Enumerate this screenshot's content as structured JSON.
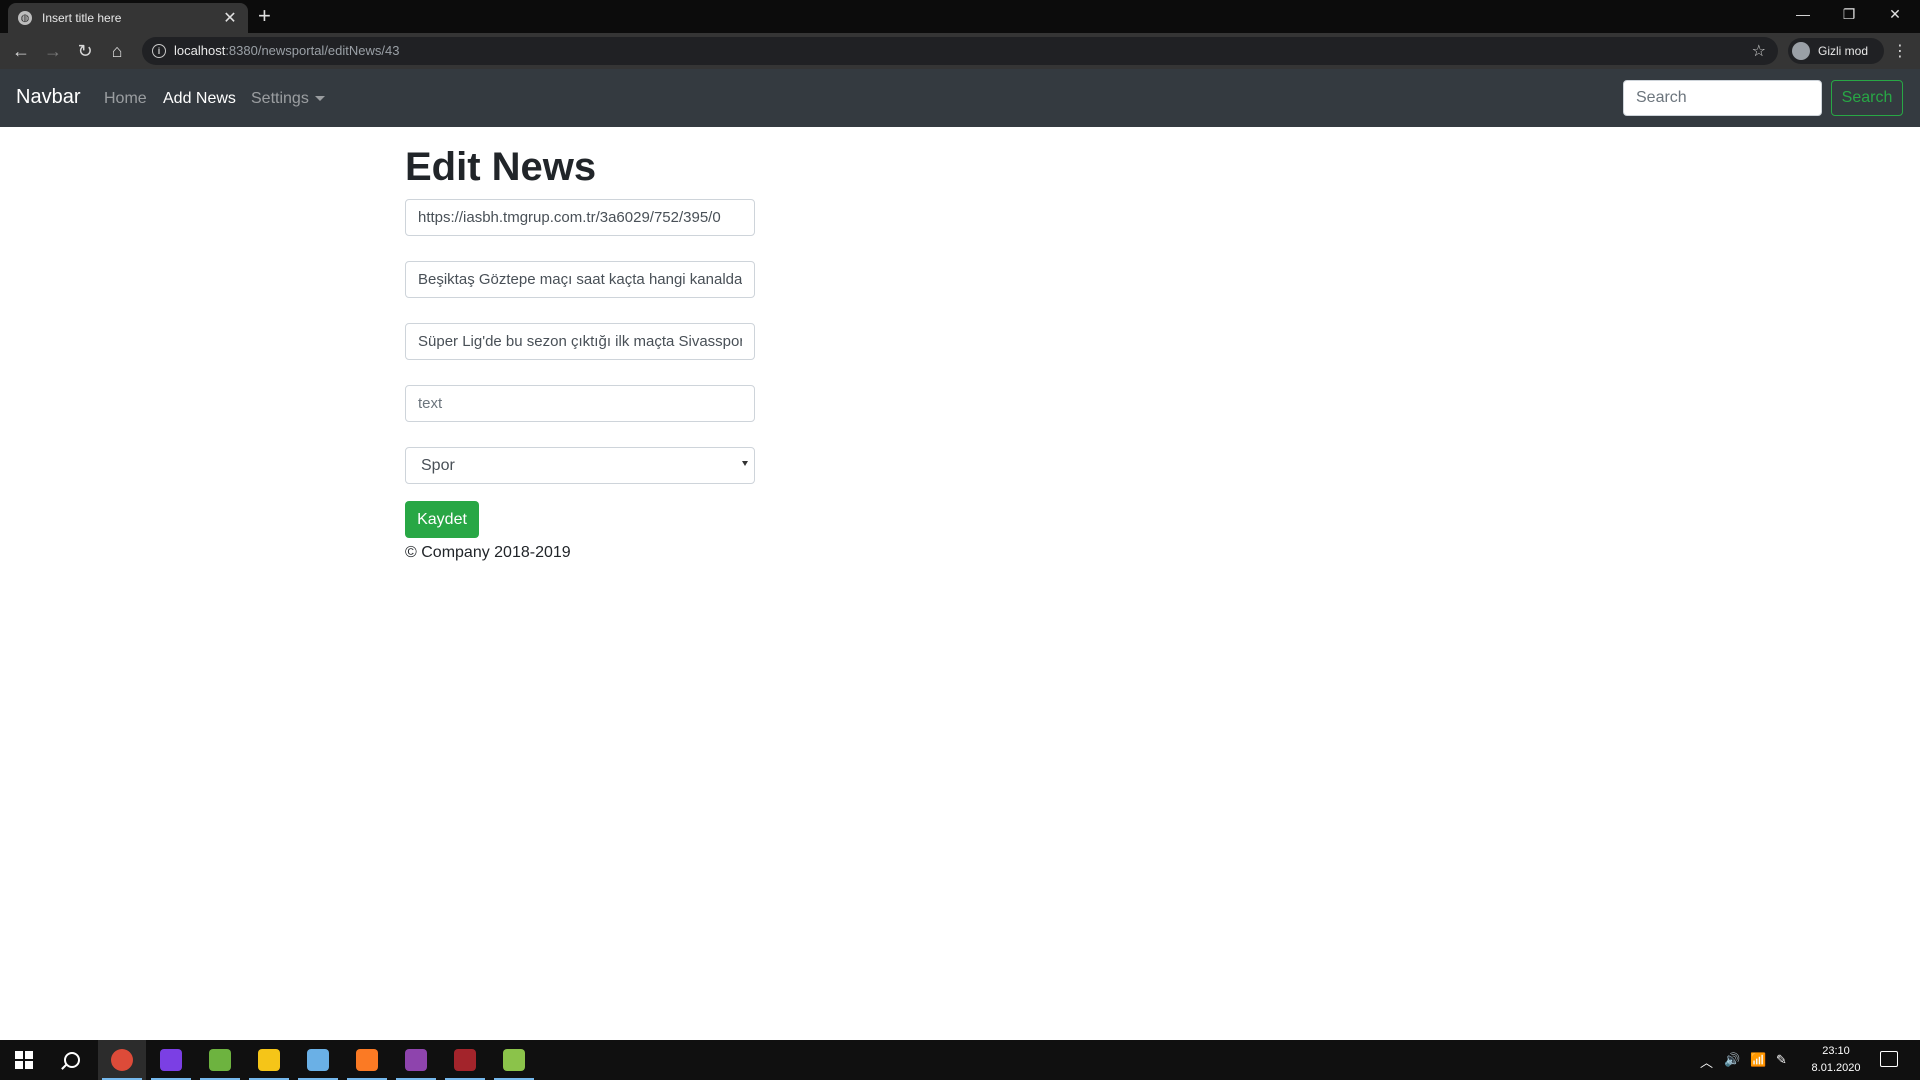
{
  "browser": {
    "tab_title": "Insert title here",
    "url_host": "localhost",
    "url_rest": ":8380/newsportal/editNews/43",
    "profile_label": "Gizli mod"
  },
  "navbar": {
    "brand": "Navbar",
    "links": [
      {
        "label": "Home"
      },
      {
        "label": "Add News"
      },
      {
        "label": "Settings"
      }
    ],
    "search_placeholder": "Search",
    "search_button": "Search"
  },
  "form": {
    "title": "Edit News",
    "image_url": "https://iasbh.tmgrup.com.tr/3a6029/752/395/0",
    "headline": "Beşiktaş Göztepe maçı saat kaçta hangi kanalda",
    "summary": "Süper Lig'de bu sezon çıktığı ilk maçta Sivasspor",
    "text_placeholder": "text",
    "category_selected": "Spor",
    "save_button": "Kaydet",
    "footer": "© Company 2018-2019"
  },
  "taskbar": {
    "apps": [
      {
        "name": "chrome",
        "color": "#dd4b39"
      },
      {
        "name": "intellij",
        "color": "#7b3fe4"
      },
      {
        "name": "spring",
        "color": "#6db33f"
      },
      {
        "name": "explorer",
        "color": "#f5c518"
      },
      {
        "name": "notepad",
        "color": "#6ab0e6"
      },
      {
        "name": "xampp",
        "color": "#fb7a24"
      },
      {
        "name": "app-purple",
        "color": "#8e44ad"
      },
      {
        "name": "winrar",
        "color": "#a3242b"
      },
      {
        "name": "notepadpp",
        "color": "#8bc34a"
      }
    ],
    "time": "23:10",
    "date": "8.01.2020"
  }
}
